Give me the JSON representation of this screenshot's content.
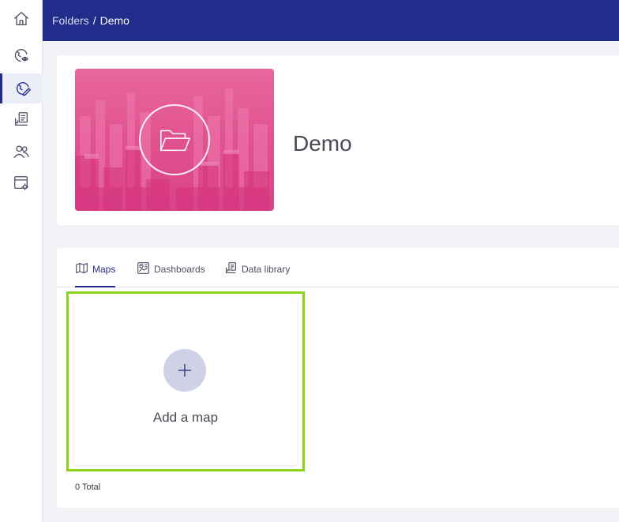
{
  "sidebar": {
    "items": [
      {
        "icon": "home-icon",
        "active": false
      },
      {
        "icon": "map-view-icon",
        "active": false
      },
      {
        "icon": "map-edit-icon",
        "active": true
      },
      {
        "icon": "data-library-icon",
        "active": false
      },
      {
        "icon": "users-icon",
        "active": false
      },
      {
        "icon": "settings-window-icon",
        "active": false
      }
    ]
  },
  "breadcrumb": {
    "parent": "Folders",
    "separator": "/",
    "current": "Demo"
  },
  "folder": {
    "title": "Demo",
    "cover_icon": "folder-open-icon"
  },
  "tabs": [
    {
      "label": "Maps",
      "icon": "map-icon",
      "active": true
    },
    {
      "label": "Dashboards",
      "icon": "dashboard-icon",
      "active": false
    },
    {
      "label": "Data library",
      "icon": "data-library-icon",
      "active": false
    }
  ],
  "add_card": {
    "label": "Add a map",
    "icon": "plus-icon"
  },
  "footer": {
    "total": "0 Total"
  },
  "colors": {
    "topbar": "#212c8b",
    "accent": "#232b8f",
    "highlight": "#8fd21e",
    "cover": "#e0508f"
  }
}
